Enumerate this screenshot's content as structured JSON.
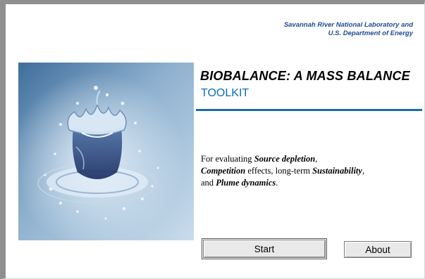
{
  "header": {
    "credit_line1": "Savannah River National Laboratory and",
    "credit_line2": "U.S. Department of Energy"
  },
  "title": {
    "line1": "BIOBALANCE: A MASS BALANCE",
    "line2": "TOOLKIT"
  },
  "description": {
    "p1": "For evaluating ",
    "source_depletion": "Source depletion",
    "p2": ",",
    "competition": "Competition",
    "p3": " effects, long-term ",
    "sustainability": "Sustainability",
    "p4": ",",
    "p5": "and ",
    "plume_dynamics": "Plume dynamics",
    "p6": "."
  },
  "buttons": {
    "start_label": "Start",
    "about_label": "About"
  },
  "colors": {
    "credit_text": "#1b4b8f",
    "title_accent": "#0a6fb5",
    "rule": "#1a6aad",
    "window_frame": "#8f8f8f"
  },
  "image": {
    "icon": "water-splash-image"
  }
}
